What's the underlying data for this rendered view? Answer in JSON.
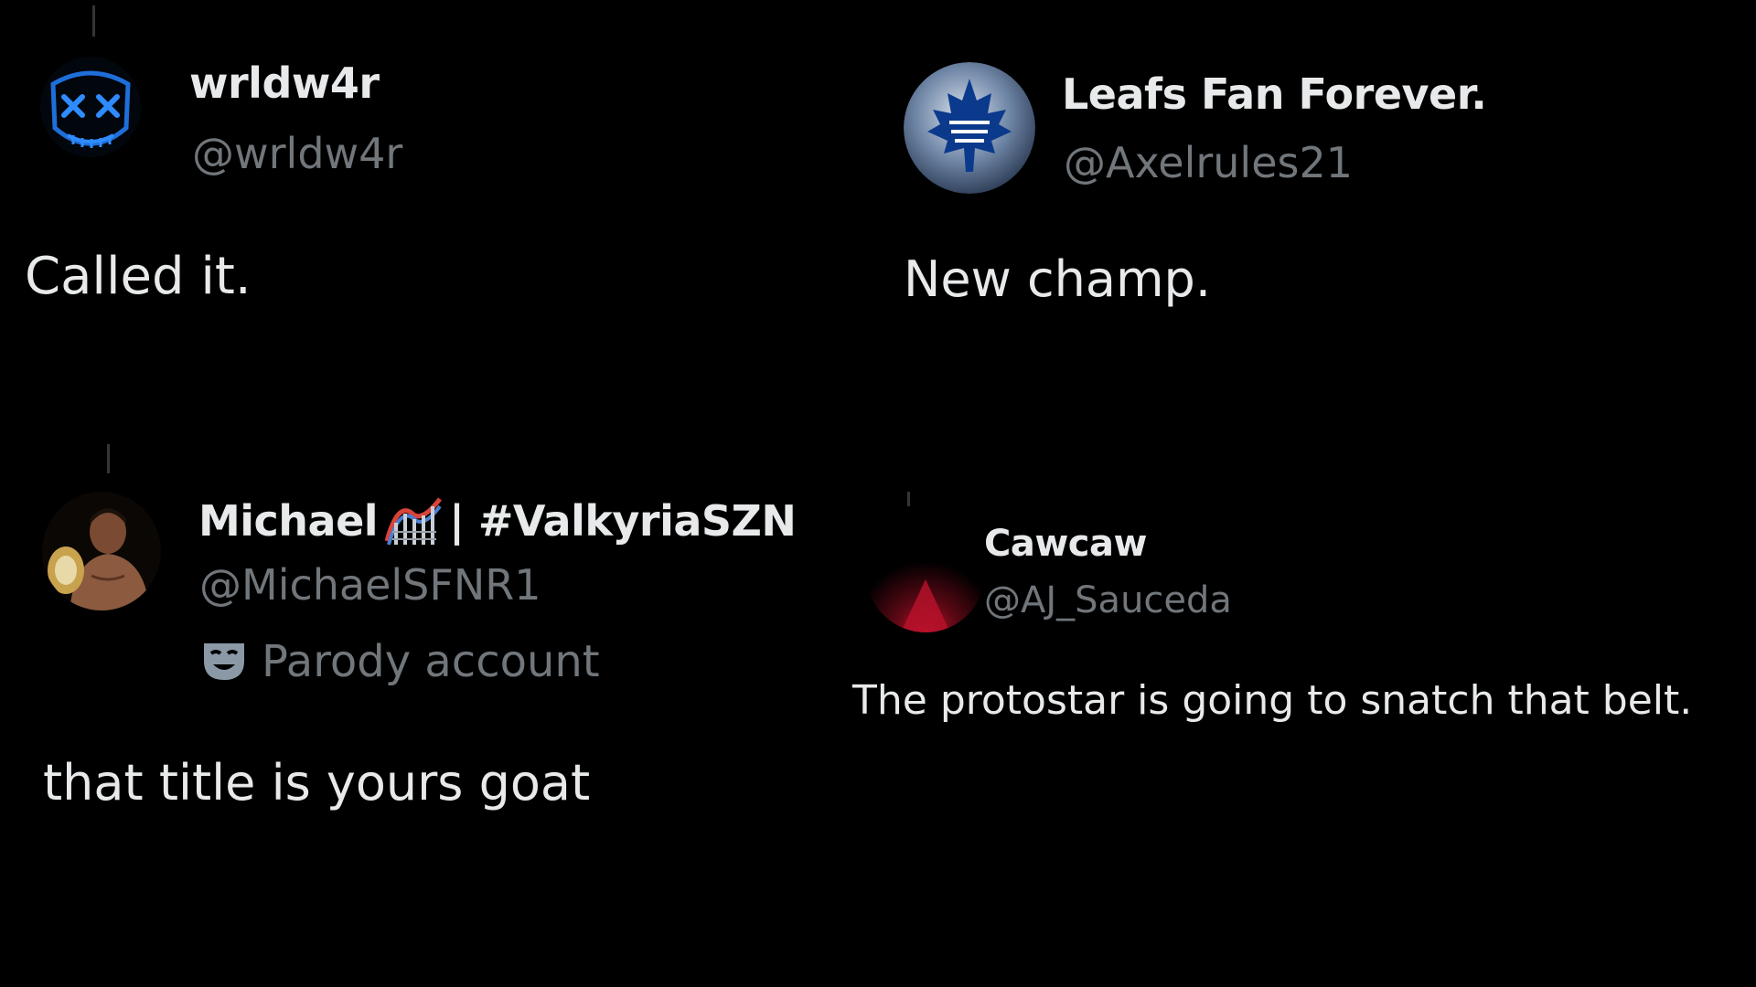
{
  "replies": [
    {
      "display_name": "wrldw4r",
      "handle": "@wrldw4r",
      "text": "Called it.",
      "avatar": "neon-x-mask-avatar"
    },
    {
      "display_name": "Leafs Fan Forever.",
      "handle": "@Axelrules21",
      "text": "New champ.",
      "avatar": "maple-leafs-logo-avatar"
    },
    {
      "display_name": "Michael",
      "name_suffix": "| #ValkyriaSZN",
      "handle": "@MichaelSFNR1",
      "badge_text": "Parody account",
      "badge_icon": "theater-mask-icon",
      "name_emoji_icon": "roller-coaster-icon",
      "text": "that title is yours goat",
      "avatar": "wrestler-with-belt-avatar"
    },
    {
      "display_name": "Cawcaw",
      "handle": "@AJ_Sauceda",
      "text": "The protostar is going to snatch that belt.",
      "avatar": "dark-red-glow-avatar"
    }
  ],
  "colors": {
    "background": "#000000",
    "primary_text": "#e7e9ea",
    "secondary_text": "#71767b",
    "thread_line": "#333639"
  }
}
